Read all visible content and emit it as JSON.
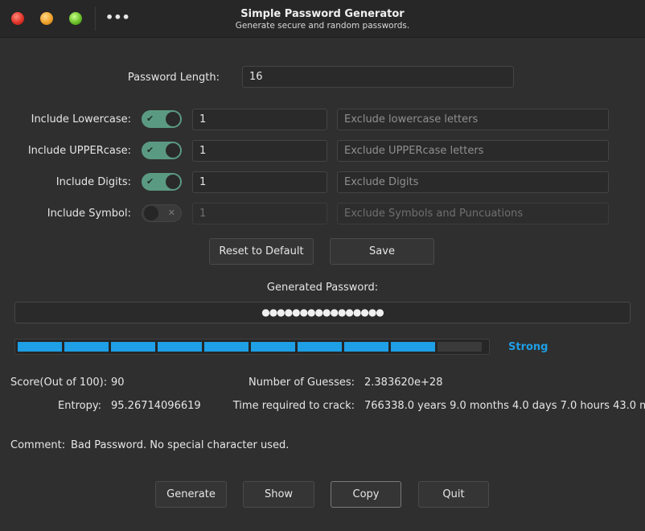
{
  "window": {
    "title": "Simple Password Generator",
    "subtitle": "Generate secure and random passwords.",
    "menu_glyph": "•••"
  },
  "length": {
    "label": "Password Length:",
    "value": "16"
  },
  "options": [
    {
      "label": "Include Lowercase:",
      "enabled": true,
      "count": "1",
      "exclude_placeholder": "Exclude lowercase letters"
    },
    {
      "label": "Include UPPERcase:",
      "enabled": true,
      "count": "1",
      "exclude_placeholder": "Exclude UPPERcase letters"
    },
    {
      "label": "Include Digits:",
      "enabled": true,
      "count": "1",
      "exclude_placeholder": "Exclude Digits"
    },
    {
      "label": "Include Symbol:",
      "enabled": false,
      "count": "1",
      "exclude_placeholder": "Exclude Symbols and Puncuations"
    }
  ],
  "actions": {
    "reset_label": "Reset to Default",
    "save_label": "Save"
  },
  "generated": {
    "label": "Generated Password:",
    "masked_value": "●●●●●●●●●●●●●●●●"
  },
  "strength": {
    "label": "Strong",
    "filled_segments": 9,
    "total_segments": 10,
    "color": "#1e9fe6"
  },
  "stats": {
    "score_label": "Score(Out of 100):",
    "score_value": "90",
    "entropy_label": "Entropy:",
    "entropy_value": "95.26714096619",
    "guesses_label": "Number of Guesses:",
    "guesses_value": "2.383620e+28",
    "crack_label": "Time required to crack:",
    "crack_value": "766338.0 years 9.0 months 4.0 days 7.0 hours 43.0 m"
  },
  "comment": {
    "label": "Comment:",
    "value": "Bad Password. No special character used."
  },
  "bottom_buttons": {
    "generate": "Generate",
    "show": "Show",
    "copy": "Copy",
    "quit": "Quit"
  },
  "toggle_marks": {
    "on": "✔",
    "off": "✕"
  }
}
